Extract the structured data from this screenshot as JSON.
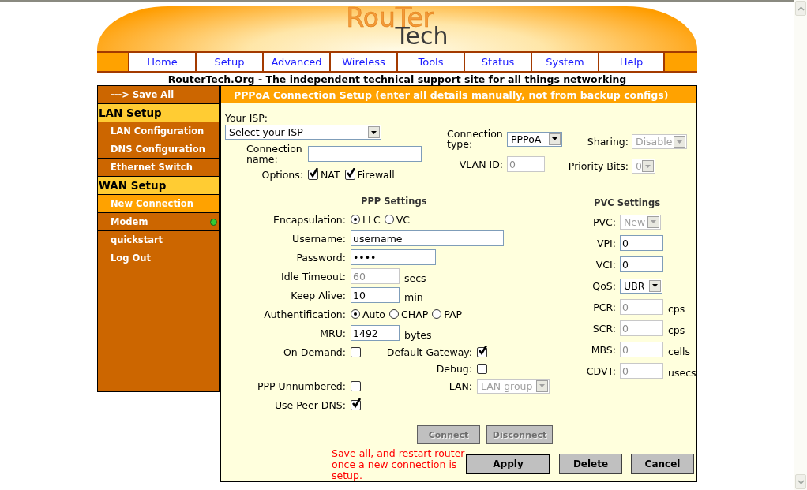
{
  "logo": {
    "top": "RouTer",
    "bottom": "Tech"
  },
  "nav": [
    "Home",
    "Setup",
    "Advanced",
    "Wireless",
    "Tools",
    "Status",
    "System",
    "Help"
  ],
  "tagline": "RouterTech.Org - The independent technical support site for all things networking",
  "sidebar": {
    "items": [
      {
        "label": "---> Save All",
        "kind": "action"
      },
      {
        "label": "LAN Setup",
        "kind": "section"
      },
      {
        "label": "LAN Configuration",
        "kind": "link",
        "selected": false
      },
      {
        "label": "DNS Configuration",
        "kind": "link",
        "selected": false
      },
      {
        "label": "Ethernet Switch",
        "kind": "link",
        "selected": false
      },
      {
        "label": "WAN Setup",
        "kind": "section"
      },
      {
        "label": "New Connection",
        "kind": "link",
        "selected": true
      },
      {
        "label": "Modem",
        "kind": "link",
        "selected": false,
        "color": "#33cc33"
      },
      {
        "label": "quickstart",
        "kind": "link",
        "selected": false
      },
      {
        "label": "Log Out",
        "kind": "link",
        "selected": false
      }
    ]
  },
  "panel": {
    "title": "PPPoA Connection Setup (enter all details manually, not from backup configs)",
    "isp": {
      "label": "Your ISP:",
      "value": "Select your ISP",
      "disabled": false
    },
    "connection_name": {
      "label": "Connection name:",
      "disabled": false
    },
    "options": {
      "label": "Options:",
      "items": [
        {
          "label": "NAT",
          "checked": true
        },
        {
          "label": "Firewall",
          "checked": true
        }
      ]
    },
    "connection_type": {
      "label": "Connection type:",
      "value": "PPPoA",
      "disabled": false
    },
    "vlan_id": {
      "label": "VLAN ID:",
      "value": "0",
      "disabled": true
    },
    "sharing": {
      "label": "Sharing:",
      "value": "Disable",
      "disabled": true
    },
    "priority_bits": {
      "label": "Priority Bits:",
      "value": "0",
      "disabled": true
    },
    "ppp_settings": {
      "title": "PPP Settings",
      "encapsulation": {
        "label": "Encapsulation:",
        "options": [
          {
            "label": "LLC",
            "selected": true
          },
          {
            "label": "VC",
            "selected": false
          }
        ]
      },
      "username": {
        "label": "Username:",
        "value": "username",
        "disabled": false
      },
      "password": {
        "label": "Password:",
        "value": "••••",
        "disabled": false
      },
      "idle_timeout": {
        "label": "Idle Timeout:",
        "value": "60",
        "unit": "secs",
        "disabled": true
      },
      "keep_alive": {
        "label": "Keep Alive:",
        "value": "10",
        "unit": "min",
        "disabled": false
      },
      "authentification": {
        "label": "Authentification:",
        "options": [
          {
            "label": "Auto",
            "selected": true
          },
          {
            "label": "CHAP",
            "selected": false
          },
          {
            "label": "PAP",
            "selected": false
          }
        ]
      },
      "mru": {
        "label": "MRU:",
        "value": "1492",
        "unit": "bytes",
        "disabled": false
      },
      "on_demand": {
        "label": "On Demand:",
        "checked": false
      },
      "default_gateway": {
        "label": "Default Gateway:",
        "checked": true
      },
      "debug": {
        "label": "Debug:",
        "checked": false
      },
      "ppp_unnumbered": {
        "label": "PPP Unnumbered:",
        "checked": false
      },
      "lan": {
        "label": "LAN:",
        "value": "LAN group ",
        "disabled": true
      },
      "use_peer_dns": {
        "label": "Use Peer DNS:",
        "checked": true
      }
    },
    "pvc_settings": {
      "title": "PVC Settings",
      "pvc": {
        "label": "PVC:",
        "value": "New",
        "disabled": true
      },
      "vpi": {
        "label": "VPI:",
        "value": "0",
        "disabled": false
      },
      "vci": {
        "label": "VCI:",
        "value": "0",
        "disabled": false
      },
      "qos": {
        "label": "QoS:",
        "value": "UBR",
        "disabled": false
      },
      "pcr": {
        "label": "PCR:",
        "value": "0",
        "unit": "cps",
        "disabled": true
      },
      "scr": {
        "label": "SCR:",
        "value": "0",
        "unit": "cps",
        "disabled": true
      },
      "mbs": {
        "label": "MBS:",
        "value": "0",
        "unit": "cells",
        "disabled": true
      },
      "cdvt": {
        "label": "CDVT:",
        "value": "0",
        "unit": "usecs",
        "disabled": true
      }
    },
    "actions": [
      {
        "label": "Connect",
        "disabled": true
      },
      {
        "label": "Disconnect",
        "disabled": true
      }
    ],
    "footer": {
      "note": "Save all, and restart router once a new connection is setup.",
      "buttons": [
        {
          "label": "Apply",
          "default": true
        },
        {
          "label": "Delete",
          "default": false
        },
        {
          "label": "Cancel",
          "default": false
        }
      ]
    }
  }
}
